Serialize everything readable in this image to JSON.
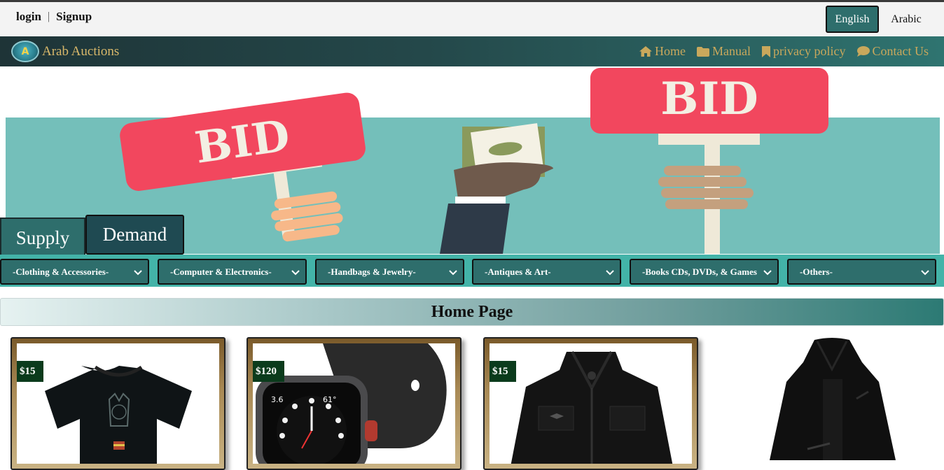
{
  "auth": {
    "login": "login",
    "separator": "|",
    "signup": "Signup"
  },
  "language": {
    "english": "English",
    "arabic": "Arabic"
  },
  "brand": {
    "logo_text": "A",
    "name": "Arab Auctions"
  },
  "nav": [
    {
      "label": "Home",
      "icon": "home-icon"
    },
    {
      "label": "Manual",
      "icon": "folder-icon"
    },
    {
      "label": "privacy policy",
      "icon": "bookmark-icon"
    },
    {
      "label": "Contact Us",
      "icon": "comment-icon"
    }
  ],
  "hero": {
    "sign_left": "BID",
    "sign_right": "BID"
  },
  "tabs": {
    "supply": "Supply",
    "demand": "Demand"
  },
  "categories": [
    "-Clothing & Accessories-",
    "-Computer & Electronics-",
    "-Handbags & Jewelry-",
    "-Antiques & Art-",
    "-Books CDs, DVDs, & Games",
    "-Others-"
  ],
  "page_title": "Home Page",
  "products": [
    {
      "price": "$15",
      "item": "black t-shirt"
    },
    {
      "price": "$120",
      "item": "smart watch"
    },
    {
      "price": "$15",
      "item": "black jacket"
    },
    {
      "price": "",
      "item": "black coat"
    }
  ],
  "colors": {
    "teal": "#2e6e6c",
    "teal_dark": "#1f4a52",
    "gold": "#c9a85c",
    "category_bar": "#43b3a8",
    "price_badge": "#0b3b1c"
  }
}
